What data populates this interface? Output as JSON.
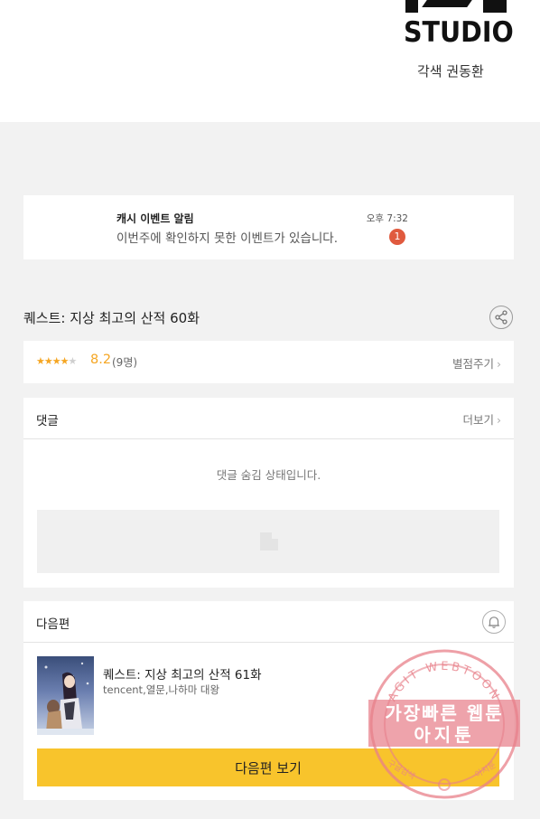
{
  "header": {
    "studio_logo_text": "STUDIO",
    "credit": "각색 권동환"
  },
  "notification": {
    "title": "캐시 이벤트 알림",
    "body": "이번주에 확인하지 못한 이벤트가 있습니다.",
    "time": "오후 7:32",
    "badge": "1"
  },
  "episode": {
    "title": "퀘스트: 지상 최고의 산적 60화",
    "share_icon": "share-icon"
  },
  "rating": {
    "stars_filled": 4,
    "stars_total": 5,
    "score": "8.2",
    "count": "(9명)",
    "rate_link": "별점주기",
    "star_color": "#f5a623"
  },
  "comments": {
    "title": "댓글",
    "more_link": "더보기",
    "hidden_message": "댓글 숨김 상태입니다."
  },
  "next_episode": {
    "section_title": "다음편",
    "title": "퀘스트: 지상 최고의 산적 61화",
    "meta": "tencent,열문,나하마 대왕",
    "button_label": "다음편 보기",
    "button_color": "#f8c42c"
  },
  "watermark": {
    "top_arc": "AGIT WEBTOON",
    "line1": "가장빠른 웹툰",
    "line2": "아지툰",
    "bottom_left": "구글검색",
    "bottom_right": "아지툰",
    "color": "#e8808a"
  }
}
